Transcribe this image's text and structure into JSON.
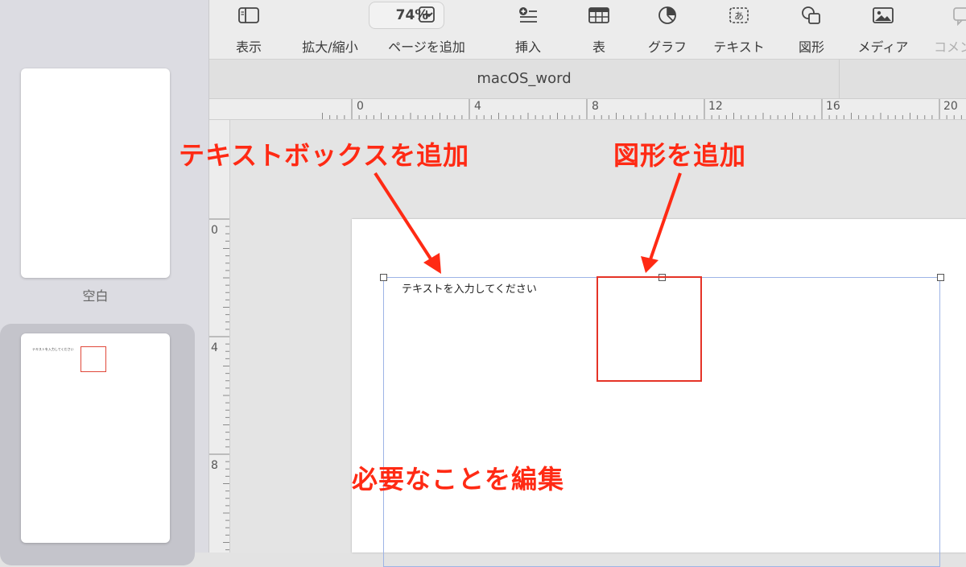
{
  "sidebar": {
    "thumbnails": [
      {
        "label": "空白"
      },
      {
        "label": "",
        "text": "テキストを入力してください"
      }
    ]
  },
  "toolbar": {
    "items": [
      {
        "label": "表示",
        "icon": "sidebar-icon"
      },
      {
        "label": "拡大/縮小",
        "value": "74%",
        "icon": "chevron-down-icon"
      },
      {
        "label": "ページを追加",
        "icon": "plus-square-icon"
      },
      {
        "label": "挿入",
        "icon": "insert-list-icon"
      },
      {
        "label": "表",
        "icon": "table-icon"
      },
      {
        "label": "グラフ",
        "icon": "chart-icon"
      },
      {
        "label": "テキスト",
        "icon": "textbox-icon"
      },
      {
        "label": "図形",
        "icon": "shape-icon"
      },
      {
        "label": "メディア",
        "icon": "media-icon"
      },
      {
        "label": "コメント",
        "icon": "comment-icon"
      }
    ]
  },
  "document": {
    "title": "macOS_word",
    "textbox_text": "テキストを入力してください"
  },
  "rulers": {
    "horizontal": [
      "0",
      "4",
      "8",
      "12",
      "16",
      "20"
    ],
    "vertical": [
      "0",
      "4",
      "8"
    ]
  },
  "annotations": {
    "textbox": "テキストボックスを追加",
    "shape": "図形を追加",
    "edit": "必要なことを編集",
    "color": "#ff2a14"
  }
}
